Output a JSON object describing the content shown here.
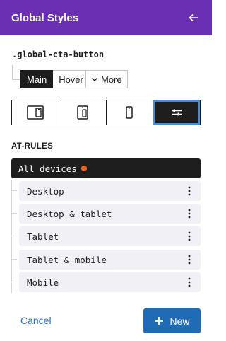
{
  "header": {
    "title": "Global Styles",
    "back_icon": "arrow-left-icon"
  },
  "selector": ".global-cta-button",
  "states": {
    "main_label": "Main",
    "hover_label": "Hover",
    "more_label": "More",
    "more_icon": "chevron-down-icon"
  },
  "device_tabs": [
    {
      "icon": "desktop-tablet-icon",
      "active": false
    },
    {
      "icon": "tablet-mobile-icon",
      "active": false
    },
    {
      "icon": "mobile-icon",
      "active": false
    },
    {
      "icon": "sliders-icon",
      "active": true
    }
  ],
  "at_rules": {
    "title": "AT-RULES",
    "all_devices_label": "All devices",
    "indicator_color": "#f0681e",
    "items": [
      {
        "label": "Desktop"
      },
      {
        "label": "Desktop & tablet"
      },
      {
        "label": "Tablet"
      },
      {
        "label": "Tablet & mobile"
      },
      {
        "label": "Mobile"
      }
    ]
  },
  "footer": {
    "cancel_label": "Cancel",
    "new_label": "New",
    "new_icon": "plus-icon"
  },
  "colors": {
    "header_bg": "#6b2fb3",
    "primary": "#1f6bb7",
    "dark": "#1e1e1e"
  }
}
